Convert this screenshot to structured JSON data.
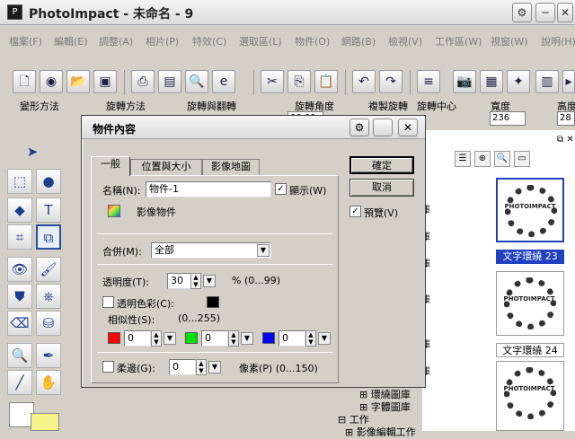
{
  "app": {
    "title": "PhotoImpact - 未命名 - 9",
    "icon": "photoimpact-icon"
  },
  "menu": [
    "檔案(F)",
    "編輯(E)",
    "調整(A)",
    "相片(P)",
    "特效(C)",
    "選取區(L)",
    "物件(O)",
    "網路(B)",
    "檢視(V)",
    "工作區(W)",
    "視窗(W)",
    "說明(H)"
  ],
  "attr_bar": {
    "labels": [
      "變形方法",
      "旋轉方法",
      "旋轉與翻轉",
      "旋轉角度",
      "複製旋轉",
      "旋轉中心",
      "寬度",
      "高度"
    ],
    "width_value": "236",
    "height_value": "28",
    "angle_value": "00.00"
  },
  "panel": {
    "tree_items": [
      "環繞圖庫",
      "字體圖庫",
      "工作",
      "影像編輯工作"
    ],
    "thumbs": [
      {
        "label": "文字環繞 23",
        "text": "PHOTOIMPACT"
      },
      {
        "label": "",
        "text": "PHOTOIMPACT"
      },
      {
        "label": "文字環繞 24",
        "text": "PHOTOIMPACT"
      }
    ]
  },
  "dialog": {
    "title": "物件內容",
    "tabs": [
      "一般",
      "位置與大小",
      "影像地圖"
    ],
    "name_label": "名稱(N):",
    "name_value": "物件-1",
    "show_label": "顯示(W)",
    "show_checked": true,
    "object_type": "影像物件",
    "merge_label": "合併(M):",
    "merge_value": "全部",
    "transparency_label": "透明度(T):",
    "transparency_value": "30",
    "transparency_range": "% (0...99)",
    "trans_color_label": "透明色彩(C):",
    "trans_color_checked": false,
    "similarity_label": "相似性(S):",
    "similarity_range": "(0...255)",
    "rgb_values": [
      "0",
      "0",
      "0"
    ],
    "soft_edge_label": "柔邊(G):",
    "soft_edge_checked": false,
    "soft_edge_value": "0",
    "soft_edge_unit": "像素(P) (0...150)",
    "ok_label": "確定",
    "cancel_label": "取消",
    "preview_label": "預覽(V)",
    "preview_checked": true
  },
  "colors": {
    "accent": "#2040c0",
    "red": "#ff0000",
    "green": "#00e000",
    "blue": "#0000ff",
    "black": "#000000"
  }
}
